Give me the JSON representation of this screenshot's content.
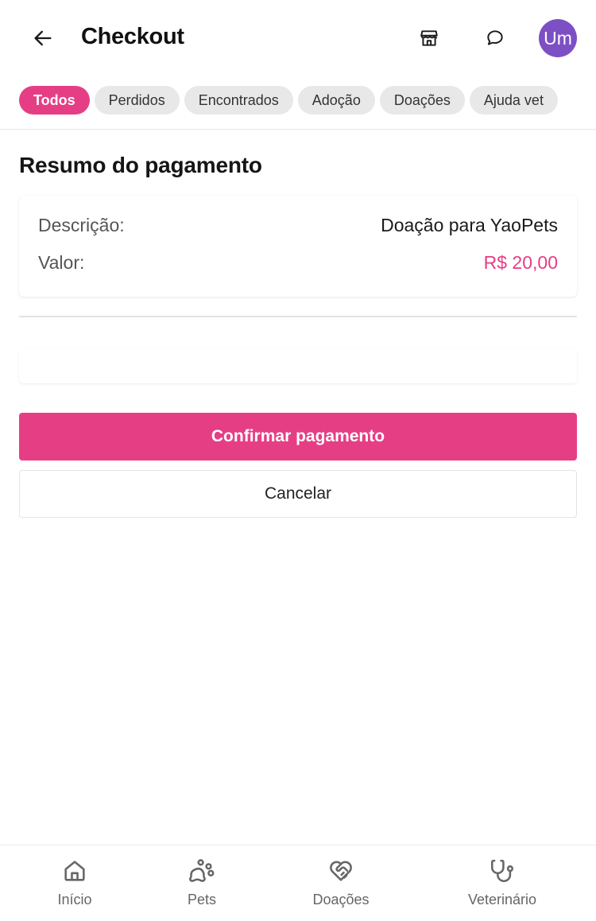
{
  "header": {
    "title": "Checkout",
    "avatar_initials": "Um",
    "avatar_color": "#7d4fc4"
  },
  "filters": {
    "chips": [
      "Todos",
      "Perdidos",
      "Encontrados",
      "Adoção",
      "Doações",
      "Ajuda vet"
    ],
    "active": "Todos",
    "accent_color": "#e63e85"
  },
  "summary": {
    "title": "Resumo do pagamento",
    "description_label": "Descrição:",
    "description_value": "Doação para YaoPets",
    "amount_label": "Valor:",
    "amount_value": "R$ 20,00"
  },
  "actions": {
    "confirm_label": "Confirmar pagamento",
    "cancel_label": "Cancelar"
  },
  "bottom_nav": {
    "items": [
      {
        "label": "Início",
        "icon": "home-icon"
      },
      {
        "label": "Pets",
        "icon": "paw-icon"
      },
      {
        "label": "Doações",
        "icon": "heart-handshake-icon"
      },
      {
        "label": "Veterinário",
        "icon": "stethoscope-icon"
      }
    ]
  },
  "icons": {
    "back": "arrow-left-icon",
    "store": "store-icon",
    "chat": "chat-bubble-icon"
  }
}
